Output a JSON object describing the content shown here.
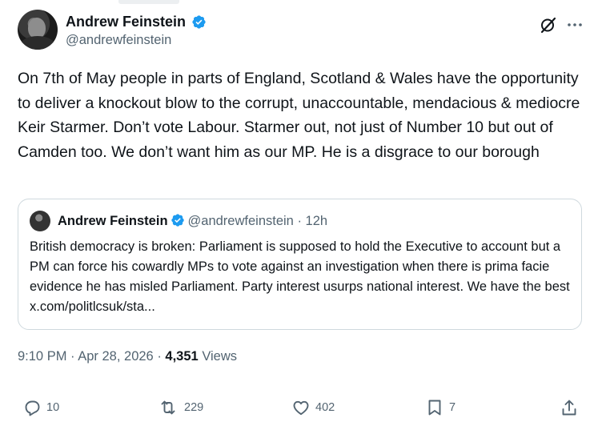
{
  "author": {
    "display_name": "Andrew Feinstein",
    "handle": "@andrewfeinstein"
  },
  "tweet": {
    "text": "On 7th of May people in parts of England, Scotland & Wales have the opportunity to deliver a knockout blow to the corrupt, unaccountable, mendacious & mediocre Keir Starmer.  Don’t vote Labour. Starmer out, not just of Number 10 but out of Camden too.  We don’t want him as our MP. He is a disgrace to our borough"
  },
  "quoted": {
    "display_name": "Andrew Feinstein",
    "handle": "@andrewfeinstein",
    "separator": "·",
    "age": "12h",
    "text": "British democracy is broken: Parliament is supposed to hold the Executive to account but a PM can force his cowardly MPs to vote against an investigation when there is prima facie evidence he has misled Parliament. Party interest usurps national interest.  We have the best x.com/politlcsuk/sta..."
  },
  "meta": {
    "time": "9:10 PM",
    "separator1": "·",
    "date": "Apr 28, 2026",
    "separator2": "·",
    "views_count": "4,351",
    "views_label": "Views"
  },
  "actions": {
    "replies": "10",
    "reposts": "229",
    "likes": "402",
    "bookmarks": "7"
  },
  "colors": {
    "verified": "#1d9bf0",
    "secondary_text": "#536471",
    "primary_text": "#0f1419",
    "border": "#cfd9de"
  },
  "icons": [
    "verified-badge-icon",
    "grok-icon",
    "more-icon",
    "reply-icon",
    "repost-icon",
    "like-icon",
    "bookmark-icon",
    "share-icon"
  ]
}
